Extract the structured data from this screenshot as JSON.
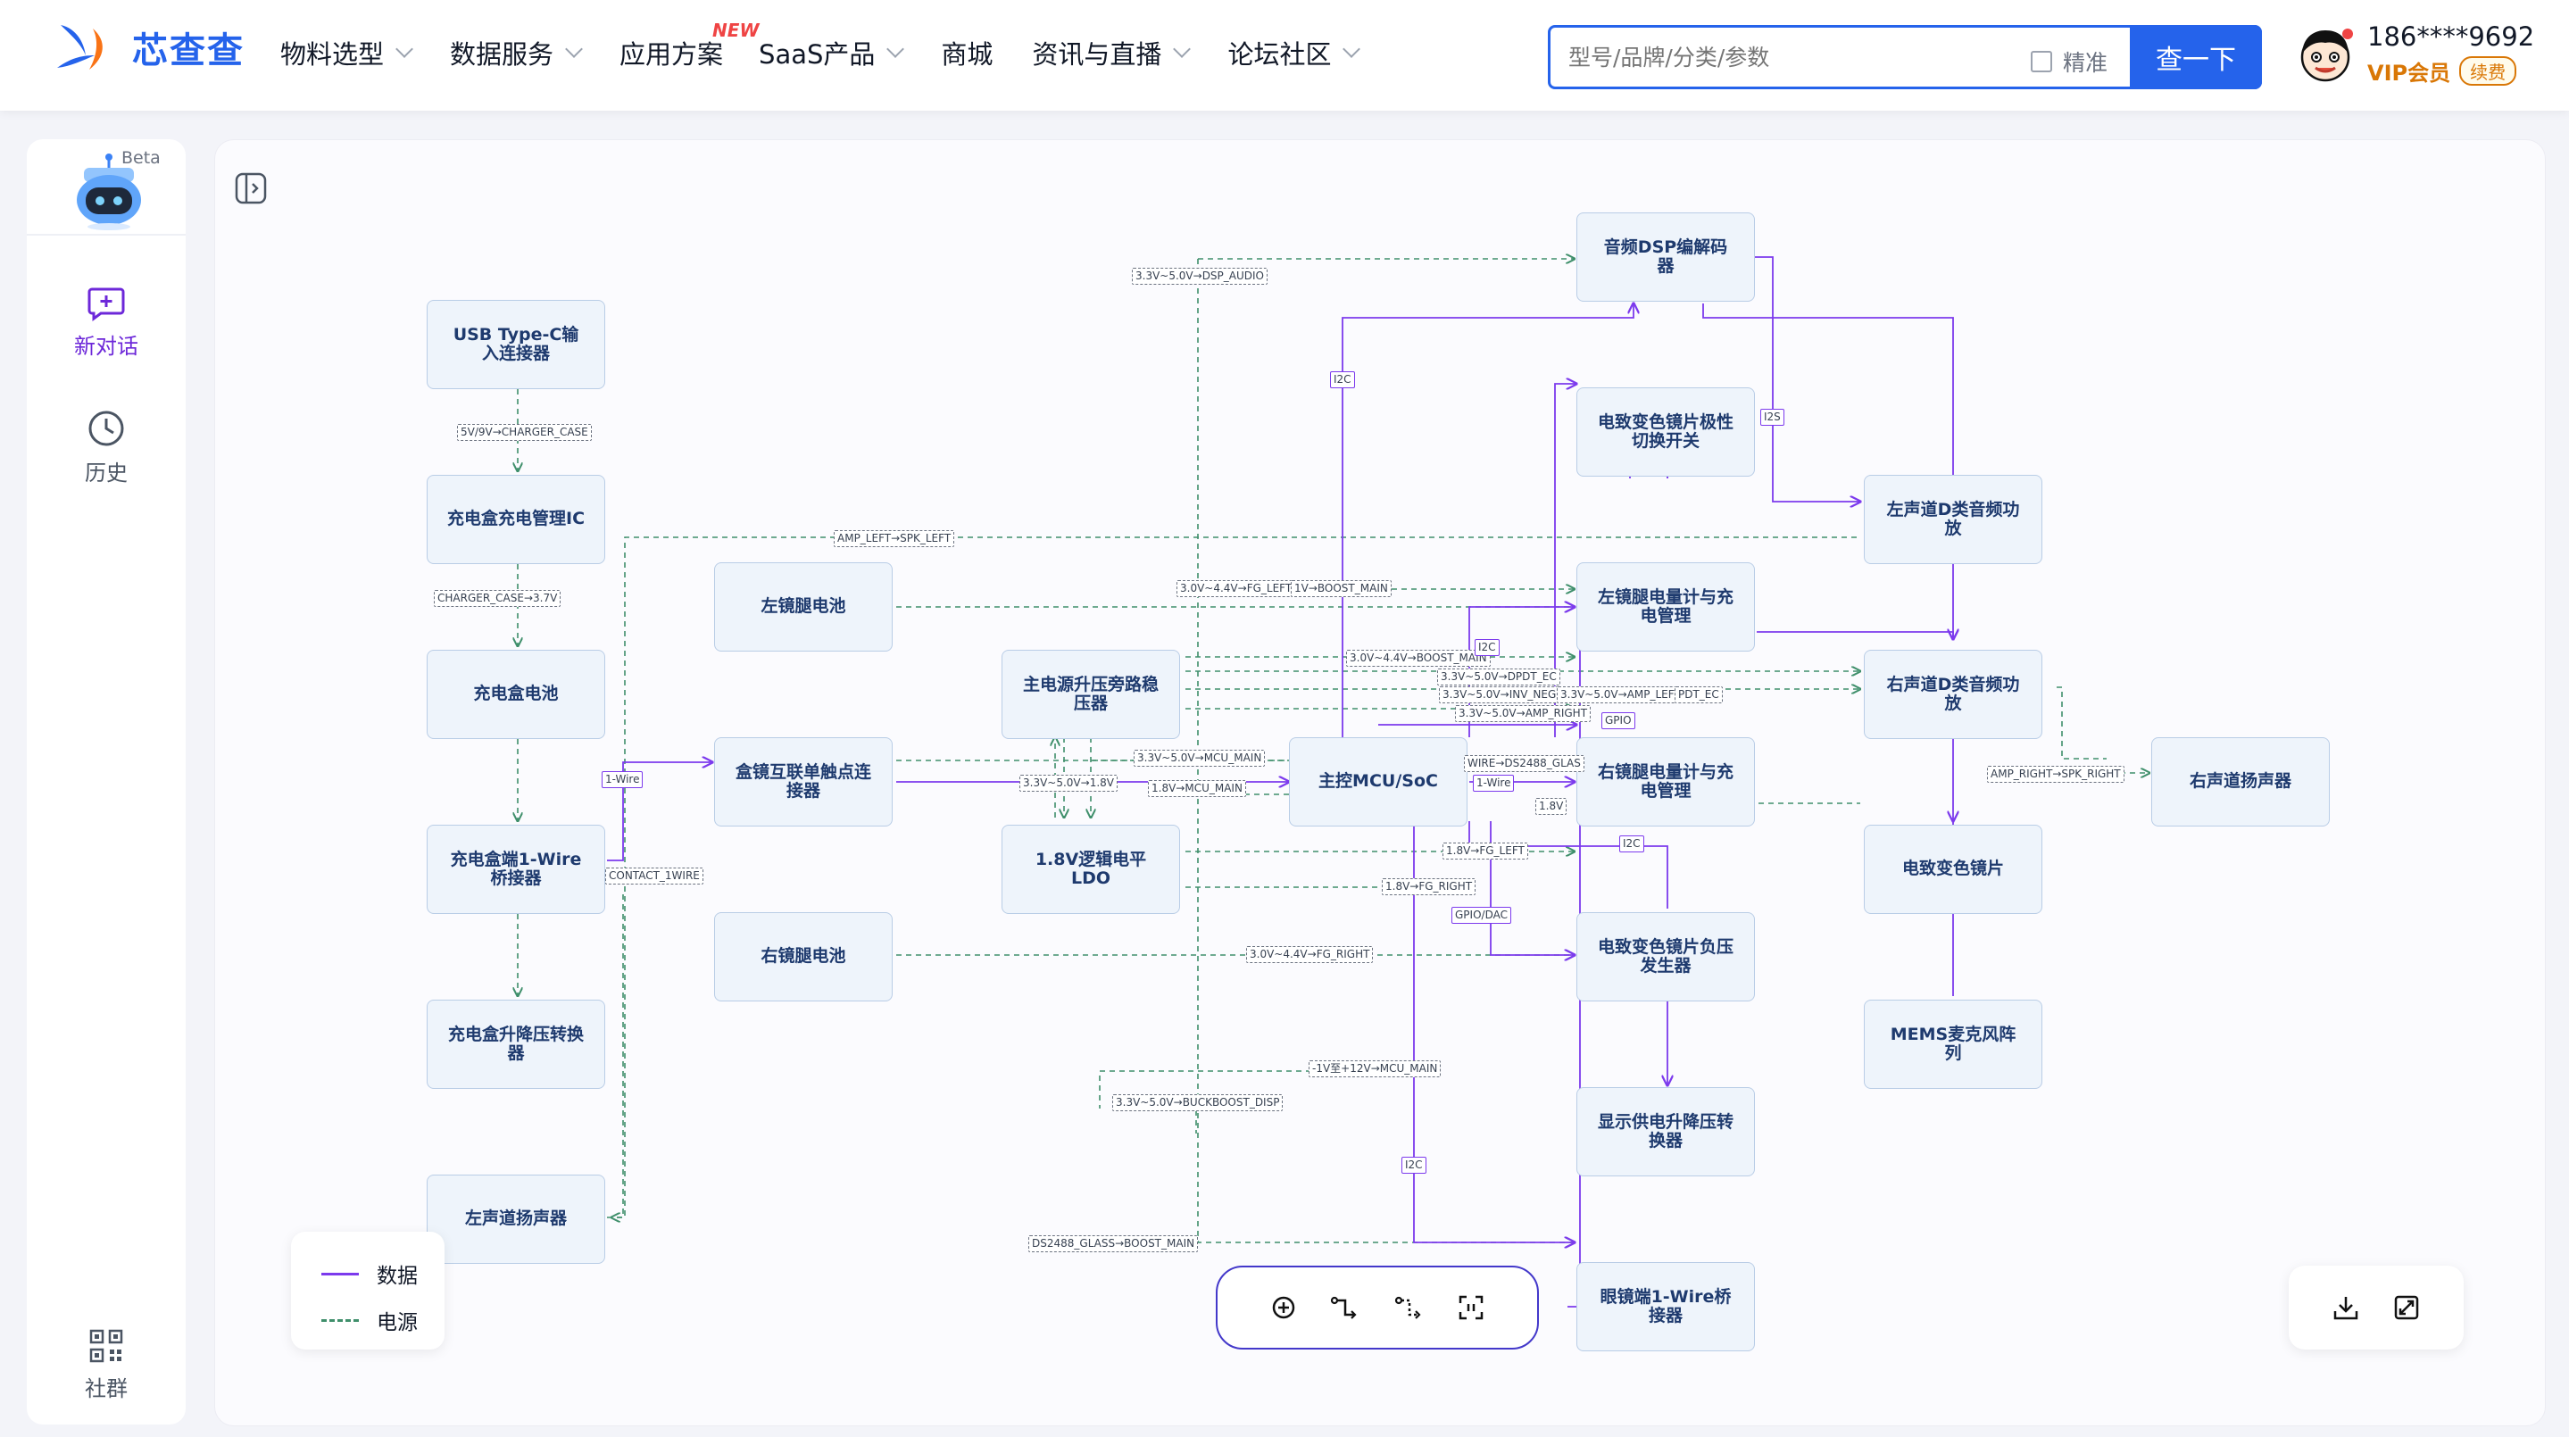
{
  "header": {
    "logo_text": "芯查查",
    "nav": [
      {
        "label": "物料选型",
        "dropdown": true
      },
      {
        "label": "数据服务",
        "dropdown": true
      },
      {
        "label": "应用方案",
        "dropdown": false
      },
      {
        "label": "SaaS产品",
        "dropdown": true,
        "badge": "NEW"
      },
      {
        "label": "商城",
        "dropdown": false
      },
      {
        "label": "资讯与直播",
        "dropdown": true
      },
      {
        "label": "论坛社区",
        "dropdown": true
      }
    ],
    "search": {
      "placeholder": "型号/品牌/分类/参数",
      "precise_label": "精准",
      "button_label": "查一下"
    },
    "user": {
      "phone": "186****9692",
      "vip_label": "VIP会员",
      "renew_label": "续费"
    }
  },
  "sidebar": {
    "beta": "Beta",
    "items": [
      {
        "label": "新对话",
        "icon": "new-chat-icon",
        "active": true
      },
      {
        "label": "历史",
        "icon": "history-icon",
        "active": false
      },
      {
        "label": "社群",
        "icon": "qrcode-icon",
        "active": false
      }
    ]
  },
  "diagram": {
    "nodes": [
      {
        "id": "usbc",
        "label": "USB Type-C输入连接器"
      },
      {
        "id": "case_chg",
        "label": "充电盒充电管理IC"
      },
      {
        "id": "case_bat",
        "label": "充电盒电池"
      },
      {
        "id": "case_1w",
        "label": "充电盒端1-Wire桥接器"
      },
      {
        "id": "case_bb",
        "label": "充电盒升降压转换器"
      },
      {
        "id": "spk_l",
        "label": "左声道扬声器"
      },
      {
        "id": "bat_l",
        "label": "左镜腿电池"
      },
      {
        "id": "contact",
        "label": "盒镜互联单触点连接器"
      },
      {
        "id": "bat_r",
        "label": "右镜腿电池"
      },
      {
        "id": "boost",
        "label": "主电源升压旁路稳压器"
      },
      {
        "id": "ldo",
        "label": "1.8V逻辑电平LDO"
      },
      {
        "id": "mcu",
        "label": "主控MCU/SoC"
      },
      {
        "id": "dsp",
        "label": "音频DSP编解码器"
      },
      {
        "id": "polsw",
        "label": "电致变色镜片极性切换开关"
      },
      {
        "id": "fg_l",
        "label": "左镜腿电量计与充电管理"
      },
      {
        "id": "fg_r",
        "label": "右镜腿电量计与充电管理"
      },
      {
        "id": "negv",
        "label": "电致变色镜片负压发生器"
      },
      {
        "id": "disp",
        "label": "显示供电升降压转换器"
      },
      {
        "id": "g_1w",
        "label": "眼镜端1-Wire桥接器"
      },
      {
        "id": "amp_l",
        "label": "左声道D类音频功放"
      },
      {
        "id": "amp_r",
        "label": "右声道D类音频功放"
      },
      {
        "id": "ec",
        "label": "电致变色镜片"
      },
      {
        "id": "mic",
        "label": "MEMS麦克风阵列"
      },
      {
        "id": "spk_r",
        "label": "右声道扬声器"
      }
    ],
    "edge_labels": [
      "3.3V~5.0V→DSP_AUDIO",
      "5V/9V→CHARGER_CASE",
      "CHARGER_CASE→3.7V",
      "AMP_LEFT→SPK_LEFT",
      "3.0V~4.4V→FG_LEFT",
      "1V→BOOST_MAIN",
      "3.0V~4.4V→BOOST_MAIN",
      "3.3V~5.0V→DPDT_EC",
      "3.3V~5.0V→INV_NEG",
      "3.3V~5.0V→AMP_LEFT",
      "PDT_EC",
      "3.3V~5.0V→AMP_RIGHT",
      "3.3V~5.0V→MCU_MAIN",
      "3.3V~5.0V→1.8V",
      "1.8V→MCU_MAIN",
      "WIRE→DS2488_GLAS",
      "1-Wire",
      "1.8V→FG_LEFT",
      "1.8V→FG_RIGHT",
      "3.0V~4.4V→FG_RIGHT",
      "-1V至+12V→MCU_MAIN",
      "3.3V~5.0V→BUCKBOOST_DISP",
      "DS2488_GLASS→BOOST_MAIN",
      "CONTACT_1WIRE",
      "AMP_RIGHT→SPK_RIGHT",
      "I2C",
      "I2S",
      "GPIO",
      "GPIO/DAC",
      "1.8V"
    ]
  },
  "legend": {
    "data": "数据",
    "power": "电源"
  },
  "colors": {
    "brand": "#2563eb",
    "data_edge": "#7c3aed",
    "power_edge": "#3f8f6b",
    "node_fill": "#eef4fb",
    "node_border": "#b9cde6"
  }
}
